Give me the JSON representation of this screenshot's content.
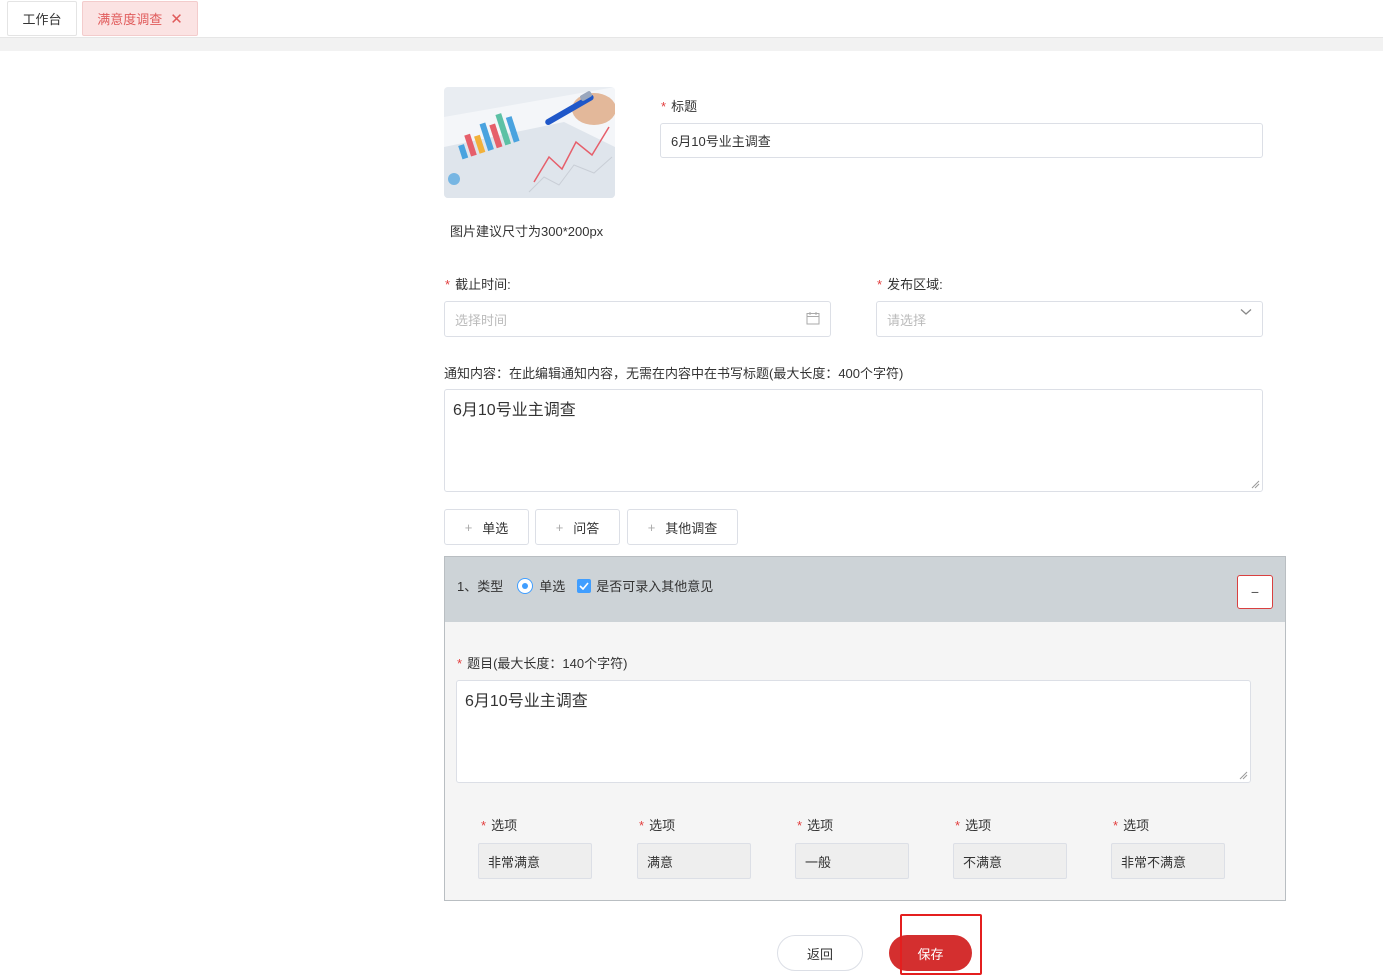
{
  "tabs": {
    "home": "工作台",
    "active": "满意度调查",
    "close_glyph": "✕"
  },
  "image": {
    "hint": "图片建议尺寸为300*200px"
  },
  "title_field": {
    "label": "标题",
    "value": "6月10号业主调查"
  },
  "deadline": {
    "label": "截止时间:",
    "placeholder": "选择时间",
    "icon": "calendar-icon"
  },
  "region": {
    "label": "发布区域:",
    "placeholder": "请选择",
    "icon": "chevron-down-icon"
  },
  "notice": {
    "label": "通知内容：在此编辑通知内容，无需在内容中在书写标题(最大长度：400个字符)",
    "value": "6月10号业主调查"
  },
  "add_buttons": [
    {
      "label": "单选"
    },
    {
      "label": "问答"
    },
    {
      "label": "其他调查"
    }
  ],
  "question": {
    "type_label": "1、类型",
    "radio_label": "单选",
    "checkbox_label": "是否可录入其他意见",
    "collapse_glyph": "−",
    "topic_label": "题目(最大长度：140个字符)",
    "topic_value": "6月10号业主调查",
    "option_label": "选项",
    "options": [
      "非常满意",
      "满意",
      "一般",
      "不满意",
      "非常不满意"
    ]
  },
  "footer": {
    "back": "返回",
    "save": "保存"
  },
  "colors": {
    "accent": "#409eff",
    "primary": "#d42f2f",
    "required": "#e23c3c",
    "panel_header": "#cdd3d7"
  }
}
